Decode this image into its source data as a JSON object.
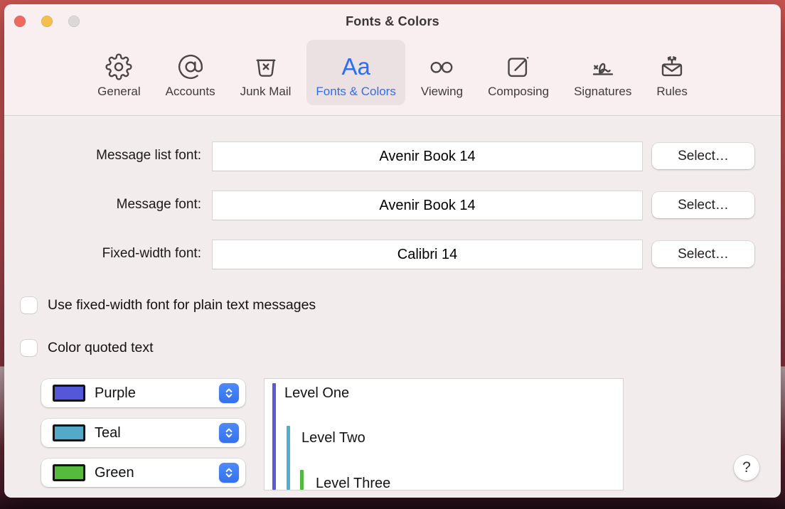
{
  "window": {
    "title": "Fonts & Colors"
  },
  "toolbar": {
    "accent_color": "#2e6ef2",
    "items": [
      {
        "label": "General",
        "icon": "gear-icon"
      },
      {
        "label": "Accounts",
        "icon": "at-sign-icon"
      },
      {
        "label": "Junk Mail",
        "icon": "junk-bin-icon"
      },
      {
        "label": "Fonts & Colors",
        "icon": "aa-glyph",
        "glyph": "Aa",
        "selected": true
      },
      {
        "label": "Viewing",
        "icon": "glasses-icon"
      },
      {
        "label": "Composing",
        "icon": "compose-icon"
      },
      {
        "label": "Signatures",
        "icon": "signature-icon"
      },
      {
        "label": "Rules",
        "icon": "rules-envelope-icon"
      }
    ]
  },
  "font_rows": [
    {
      "label": "Message list font:",
      "value": "Avenir Book 14",
      "button": "Select…"
    },
    {
      "label": "Message font:",
      "value": "Avenir Book 14",
      "button": "Select…"
    },
    {
      "label": "Fixed-width font:",
      "value": "Calibri 14",
      "button": "Select…"
    }
  ],
  "checkboxes": [
    {
      "label": "Use fixed-width font for plain text messages",
      "checked": false
    },
    {
      "label": "Color quoted text",
      "checked": false
    }
  ],
  "quoted_text_colors": [
    {
      "name": "Purple",
      "swatch": "#5457d8"
    },
    {
      "name": "Teal",
      "swatch": "#53a9c6"
    },
    {
      "name": "Green",
      "swatch": "#56ba3c"
    }
  ],
  "preview": {
    "levels": [
      {
        "label": "Level One",
        "bar_color": "#5b58da"
      },
      {
        "label": "Level Two",
        "bar_color": "#4fb0cd"
      },
      {
        "label": "Level Three",
        "bar_color": "#4fbb3c"
      }
    ]
  },
  "help_button": {
    "label": "?"
  }
}
